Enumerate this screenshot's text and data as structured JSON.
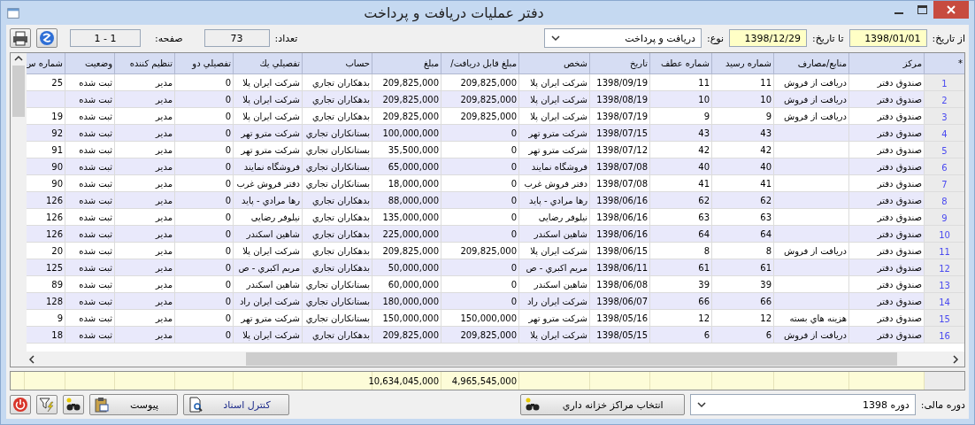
{
  "window": {
    "title": "دفتر عملیات دریافت و پرداخت"
  },
  "filters": {
    "from_date": {
      "label": "از تاریخ:",
      "value": "1398/01/01"
    },
    "to_date": {
      "label": "تا تاریخ:",
      "value": "1398/12/29"
    },
    "type": {
      "label": "نوع:",
      "value": "دریافت و پرداخت"
    },
    "count": {
      "label": "تعداد:",
      "value": "73"
    },
    "page": {
      "label": "صفحه:",
      "value": "1 - 1"
    }
  },
  "table": {
    "columns": [
      "*",
      "مرکز",
      "منابع/مصارف",
      "شماره رسید",
      "شماره عطف",
      "تاریخ",
      "شخص",
      "مبلغ قابل دریافت/",
      "مبلغ",
      "حساب",
      "تفصیلي يك",
      "تفصیلي دو",
      "تنظیم کننده",
      "وضعیت",
      "شماره س"
    ],
    "rows": [
      {
        "row_number": "1",
        "center": "صندوق دفتر",
        "source": "دریافت از فروش",
        "receipt_no": "11",
        "reference_no": "11",
        "date": "1398/09/19",
        "person": "شرکت ایران پلا",
        "receivable_amount": "209,825,000",
        "amount": "209,825,000",
        "account": "بدهکاران تجاري",
        "detail_1": "شرکت ایران پلا",
        "detail_2": "0",
        "creator": "مدیر",
        "status": "ثبت شده",
        "column_15": "25"
      },
      {
        "row_number": "2",
        "center": "صندوق دفتر",
        "source": "دریافت از فروش",
        "receipt_no": "10",
        "reference_no": "10",
        "date": "1398/08/19",
        "person": "شرکت ایران پلا",
        "receivable_amount": "209,825,000",
        "amount": "209,825,000",
        "account": "بدهکاران تجاري",
        "detail_1": "شرکت ایران پلا",
        "detail_2": "0",
        "creator": "مدیر",
        "status": "ثبت شده"
      },
      {
        "row_number": "3",
        "center": "صندوق دفتر",
        "source": "دریافت از فروش",
        "receipt_no": "9",
        "reference_no": "9",
        "date": "1398/07/19",
        "person": "شرکت ایران پلا",
        "receivable_amount": "209,825,000",
        "amount": "209,825,000",
        "account": "بدهکاران تجاري",
        "detail_1": "شرکت ایران پلا",
        "detail_2": "0",
        "creator": "مدیر",
        "status": "ثبت شده",
        "column_15": "19"
      },
      {
        "row_number": "4",
        "center": "صندوق دفتر",
        "receipt_no": "43",
        "reference_no": "43",
        "date": "1398/07/15",
        "person": "شرکت مترو تهر",
        "receivable_amount": "0",
        "amount": "100,000,000",
        "account": "بستانکاران تجاري",
        "detail_1": "شرکت مترو تهر",
        "detail_2": "0",
        "creator": "مدیر",
        "status": "ثبت شده",
        "column_15": "92"
      },
      {
        "row_number": "5",
        "center": "صندوق دفتر",
        "receipt_no": "42",
        "reference_no": "42",
        "date": "1398/07/12",
        "person": "شرکت مترو تهر",
        "receivable_amount": "0",
        "amount": "35,500,000",
        "account": "بستانکاران تجاري",
        "detail_1": "شرکت مترو تهر",
        "detail_2": "0",
        "creator": "مدیر",
        "status": "ثبت شده",
        "column_15": "91"
      },
      {
        "row_number": "6",
        "center": "صندوق دفتر",
        "receipt_no": "40",
        "reference_no": "40",
        "date": "1398/07/08",
        "person": "فروشگاه نمایند",
        "receivable_amount": "0",
        "amount": "65,000,000",
        "account": "بستانکاران تجاري",
        "detail_1": "فروشگاه نمایند",
        "detail_2": "0",
        "creator": "مدیر",
        "status": "ثبت شده",
        "column_15": "90"
      },
      {
        "row_number": "7",
        "center": "صندوق دفتر",
        "receipt_no": "41",
        "reference_no": "41",
        "date": "1398/07/08",
        "person": "دفتر فروش غرب",
        "receivable_amount": "0",
        "amount": "18,000,000",
        "account": "بستانکاران تجاري",
        "detail_1": "دفتر فروش غرب",
        "detail_2": "0",
        "creator": "مدیر",
        "status": "ثبت شده",
        "column_15": "90"
      },
      {
        "row_number": "8",
        "center": "صندوق دفتر",
        "receipt_no": "62",
        "reference_no": "62",
        "date": "1398/06/16",
        "person": "رها مرادي - پاید",
        "receivable_amount": "0",
        "amount": "88,000,000",
        "account": "بدهکاران تجاري",
        "detail_1": "رها مرادي - پاید",
        "detail_2": "0",
        "creator": "مدیر",
        "status": "ثبت شده",
        "column_15": "126"
      },
      {
        "row_number": "9",
        "center": "صندوق دفتر",
        "receipt_no": "63",
        "reference_no": "63",
        "date": "1398/06/16",
        "person": "نیلوفر رضایی",
        "receivable_amount": "0",
        "amount": "135,000,000",
        "account": "بدهکاران تجاري",
        "detail_1": "نیلوفر رضایی",
        "detail_2": "0",
        "creator": "مدیر",
        "status": "ثبت شده",
        "column_15": "126"
      },
      {
        "row_number": "10",
        "center": "صندوق دفتر",
        "receipt_no": "64",
        "reference_no": "64",
        "date": "1398/06/16",
        "person": "شاهین اسکندر",
        "receivable_amount": "0",
        "amount": "225,000,000",
        "account": "بدهکاران تجاري",
        "detail_1": "شاهین اسکندر",
        "detail_2": "0",
        "creator": "مدیر",
        "status": "ثبت شده",
        "column_15": "126"
      },
      {
        "row_number": "11",
        "center": "صندوق دفتر",
        "source": "دریافت از فروش",
        "receipt_no": "8",
        "reference_no": "8",
        "date": "1398/06/15",
        "person": "شرکت ایران پلا",
        "receivable_amount": "209,825,000",
        "amount": "209,825,000",
        "account": "بدهکاران تجاري",
        "detail_1": "شرکت ایران پلا",
        "detail_2": "0",
        "creator": "مدیر",
        "status": "ثبت شده",
        "column_15": "20"
      },
      {
        "row_number": "12",
        "center": "صندوق دفتر",
        "receipt_no": "61",
        "reference_no": "61",
        "date": "1398/06/11",
        "person": "مریم اکبري - ص",
        "receivable_amount": "0",
        "amount": "50,000,000",
        "account": "بدهکاران تجاري",
        "detail_1": "مریم اکبري - ص",
        "detail_2": "0",
        "creator": "مدیر",
        "status": "ثبت شده",
        "column_15": "125"
      },
      {
        "row_number": "13",
        "center": "صندوق دفتر",
        "receipt_no": "39",
        "reference_no": "39",
        "date": "1398/06/08",
        "person": "شاهین اسکندر",
        "receivable_amount": "0",
        "amount": "60,000,000",
        "account": "بستانکاران تجاري",
        "detail_1": "شاهین اسکندر",
        "detail_2": "0",
        "creator": "مدیر",
        "status": "ثبت شده",
        "column_15": "89"
      },
      {
        "row_number": "14",
        "center": "صندوق دفتر",
        "receipt_no": "66",
        "reference_no": "66",
        "date": "1398/06/07",
        "person": "شرکت ایران راد",
        "receivable_amount": "0",
        "amount": "180,000,000",
        "account": "بستانکاران تجاري",
        "detail_1": "شرکت ایران راد",
        "detail_2": "0",
        "creator": "مدیر",
        "status": "ثبت شده",
        "column_15": "128"
      },
      {
        "row_number": "15",
        "center": "صندوق دفتر",
        "source": "هزینه هاي بسته",
        "receipt_no": "12",
        "reference_no": "12",
        "date": "1398/05/16",
        "person": "شرکت مترو تهر",
        "receivable_amount": "150,000,000",
        "amount": "150,000,000",
        "account": "بستانکاران تجاري",
        "detail_1": "شرکت مترو تهر",
        "detail_2": "0",
        "creator": "مدیر",
        "status": "ثبت شده",
        "column_15": "9"
      },
      {
        "row_number": "16",
        "center": "صندوق دفتر",
        "source": "دریافت از فروش",
        "receipt_no": "6",
        "reference_no": "6",
        "date": "1398/05/15",
        "person": "شرکت ایران پلا",
        "receivable_amount": "209,825,000",
        "amount": "209,825,000",
        "account": "بدهکاران تجاري",
        "detail_1": "شرکت ایران پلا",
        "detail_2": "0",
        "creator": "مدیر",
        "status": "ثبت شده",
        "column_15": "18"
      }
    ],
    "totals": {
      "receivable_amount": "4,965,545,000",
      "amount": "10,634,045,000"
    }
  },
  "footer": {
    "fiscal_period": {
      "label": "دوره مالی:",
      "value": "دوره 1398"
    },
    "select_centers_button": "انتخاب مراکز خزانه داري",
    "documents_button": "کنترل اسناد",
    "attachment_button": "پیوست"
  }
}
